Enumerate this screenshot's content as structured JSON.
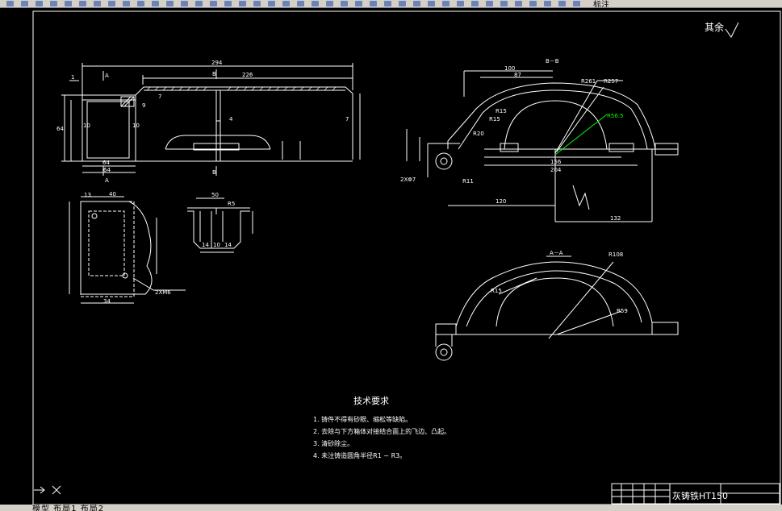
{
  "app": {
    "toolbar_label": "标注",
    "status_text": "模型  布局1  布局2"
  },
  "drawing": {
    "roughness": "其余",
    "section_bb": "B－B",
    "section_aa": "A－A",
    "label_a": "A",
    "label_b": "B",
    "tech_title": "技术要求",
    "tech_items": [
      "1. 铸件不得有砂眼、缩松等缺陷。",
      "2. 去除与下方箱体对接结合面上的飞边、凸起。",
      "3. 清砂除尘。",
      "4. 未注铸造圆角半径R1 ~ R3。"
    ],
    "material": "灰铸铁HT150",
    "title_note": "",
    "dims": {
      "d294": "294",
      "d226": "226",
      "d100": "100",
      "d87": "87",
      "d156": "156",
      "d204": "204",
      "d120": "120",
      "d132": "132",
      "d64a": "64",
      "d64b": "64",
      "d34": "34",
      "d40": "40",
      "d13": "13",
      "d50": "50",
      "d14": "14",
      "d10": "10",
      "d4": "4",
      "d7": "7",
      "d9": "9",
      "d1": "1",
      "r261": "R261",
      "r257": "R257",
      "r56": "R56.5",
      "r15a": "R15",
      "r15b": "R15",
      "r20": "R20",
      "r11": "R11",
      "r59": "R59",
      "r108": "R108",
      "r5": "R5",
      "hole": "2XΦ7",
      "hole2": "2XM6"
    }
  }
}
